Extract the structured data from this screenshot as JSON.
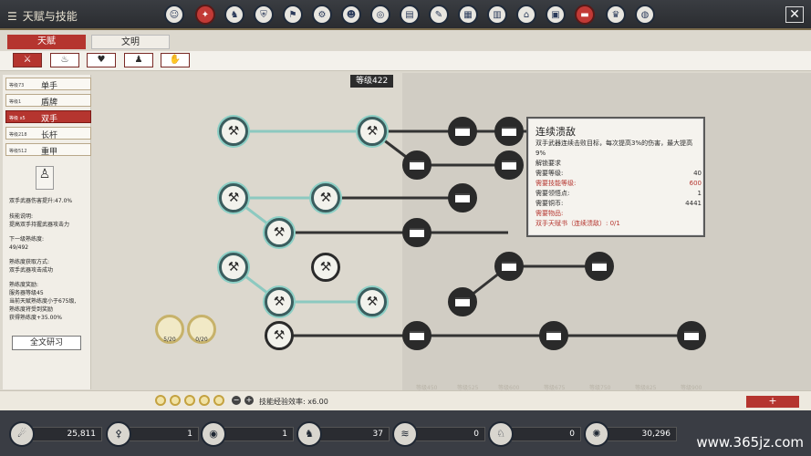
{
  "window": {
    "title": "天赋与技能",
    "close_icon": "✕"
  },
  "tabs": [
    {
      "label": "天赋"
    },
    {
      "label": "文明"
    }
  ],
  "weapons": [
    {
      "level": "等级73",
      "name": "单手"
    },
    {
      "level": "等级1",
      "name": "盾牌"
    },
    {
      "level": "等级 x5",
      "name": "双手"
    },
    {
      "level": "等级218",
      "name": "长杆"
    },
    {
      "level": "等级512",
      "name": "重甲"
    }
  ],
  "panel": {
    "damage": "双手武器伤害提升:47.0%",
    "skill_label": "技能说明:",
    "skill_desc": "提高双手持握武器攻击力",
    "next_label": "下一级熟练度:",
    "next_value": "49/492",
    "method_label": "熟练度获取方式:",
    "method_value": "双手武器攻击成功",
    "bonus_label": "熟练度奖励:",
    "bonus_1": "服务器等级45",
    "bonus_2": "当前天赋熟练度小于675级,",
    "bonus_3": "熟练度将受到奖励",
    "bonus_4": "获得熟练度+35.00%",
    "full_button": "全文研习",
    "badge1": "5/20",
    "badge2": "0/20"
  },
  "tree": {
    "level_label": "等级422"
  },
  "tooltip": {
    "title": "连续溃敌",
    "desc": "双手武器连续击败目标，每次提高3%的伤害，最大提高9%",
    "req_header": "解锁要求",
    "req_level_label": "需要等级:",
    "req_level_value": "40",
    "req_skill_label": "需要技能等级:",
    "req_skill_value": "600",
    "req_points_label": "需要领悟点:",
    "req_points_value": "1",
    "req_coins_label": "需要铜币:",
    "req_coins_value": "4441",
    "req_item_label": "需要物品:",
    "req_item_value": "双手天赋书（连续溃敌）: 0/1"
  },
  "axis_labels": [
    "等级450",
    "等级525",
    "等级600",
    "等级675",
    "等级750",
    "等级825",
    "等级900"
  ],
  "bottom": {
    "exp_label": "技能经验效率: x6.00",
    "plus": "+"
  },
  "resources": [
    "25,811",
    "1",
    "1",
    "37",
    "0",
    "30,296"
  ],
  "watermark": "www.365jz.com"
}
